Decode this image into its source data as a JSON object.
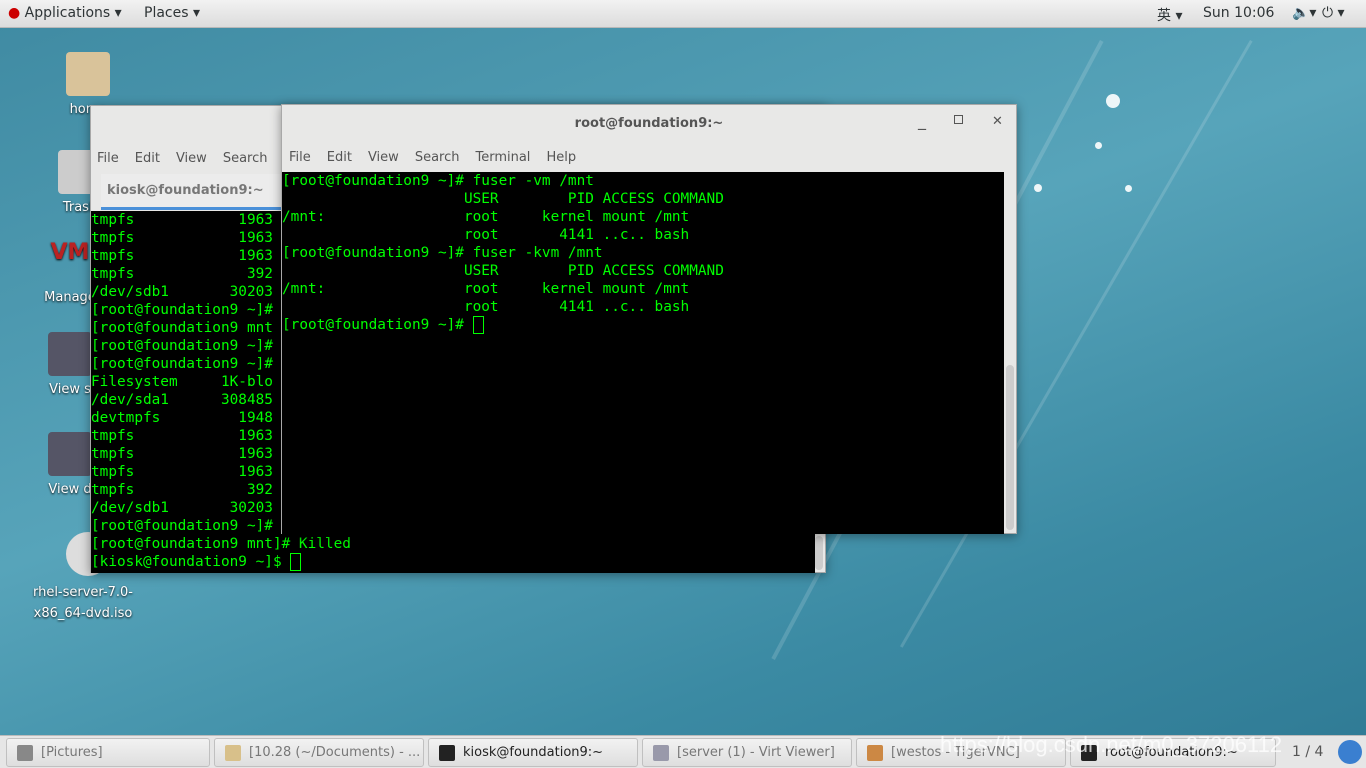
{
  "topbar": {
    "applications": "Applications",
    "places": "Places",
    "input_method": "英",
    "clock": "Sun 10:06"
  },
  "desktop": {
    "icons": [
      {
        "label": "home"
      },
      {
        "label": "Trash"
      },
      {
        "label": "Manage"
      },
      {
        "label": "View s"
      },
      {
        "label": "View d"
      },
      {
        "label": "rhel-server-7.0-x86_64-dvd.iso"
      }
    ]
  },
  "back_window": {
    "menu": [
      "File",
      "Edit",
      "View",
      "Search"
    ],
    "tab_title": "kiosk@foundation9:~",
    "lines": [
      "tmpfs            1963",
      "tmpfs            1963",
      "tmpfs            1963",
      "tmpfs             392",
      "/dev/sdb1       30203",
      "[root@foundation9 ~]#",
      "[root@foundation9 mnt",
      "[root@foundation9 ~]#",
      "[root@foundation9 ~]#",
      "Filesystem     1K-blo",
      "/dev/sda1      308485",
      "devtmpfs         1948",
      "tmpfs            1963",
      "tmpfs            1963",
      "tmpfs            1963",
      "tmpfs             392",
      "/dev/sdb1       30203",
      "[root@foundation9 ~]#",
      "[root@foundation9 mnt]# Killed",
      "[kiosk@foundation9 ~]$ "
    ]
  },
  "front_window": {
    "title": "root@foundation9:~",
    "menu": [
      "File",
      "Edit",
      "View",
      "Search",
      "Terminal",
      "Help"
    ],
    "lines": [
      "[root@foundation9 ~]# fuser -vm /mnt",
      "                     USER        PID ACCESS COMMAND",
      "/mnt:                root     kernel mount /mnt",
      "                     root       4141 ..c.. bash",
      "[root@foundation9 ~]# fuser -kvm /mnt",
      "                     USER        PID ACCESS COMMAND",
      "/mnt:                root     kernel mount /mnt",
      "                     root       4141 ..c.. bash",
      "[root@foundation9 ~]# "
    ]
  },
  "taskbar": {
    "items": [
      "[Pictures]",
      "[10.28 (~/Documents) - ...",
      "kiosk@foundation9:~",
      "[server (1) - Virt Viewer]",
      "[westos - TigerVNC]",
      "root@foundation9:~"
    ],
    "workspace": "1 / 4",
    "watermark": "https://blog.csdn.net/m0_37206112"
  }
}
